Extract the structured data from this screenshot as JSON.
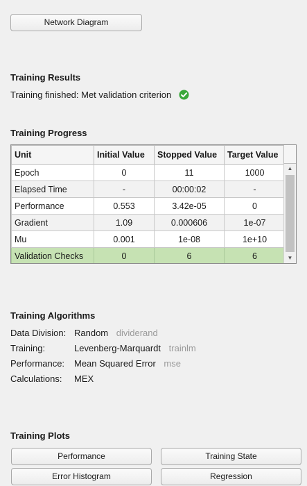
{
  "network_diagram_button": "Network Diagram",
  "results": {
    "heading": "Training Results",
    "status_text": "Training finished: Met validation criterion"
  },
  "progress": {
    "heading": "Training Progress",
    "columns": [
      "Unit",
      "Initial Value",
      "Stopped Value",
      "Target Value"
    ],
    "rows": [
      {
        "unit": "Epoch",
        "initial": "0",
        "stopped": "11",
        "target": "1000"
      },
      {
        "unit": "Elapsed Time",
        "initial": "-",
        "stopped": "00:00:02",
        "target": "-"
      },
      {
        "unit": "Performance",
        "initial": "0.553",
        "stopped": "3.42e-05",
        "target": "0"
      },
      {
        "unit": "Gradient",
        "initial": "1.09",
        "stopped": "0.000606",
        "target": "1e-07"
      },
      {
        "unit": "Mu",
        "initial": "0.001",
        "stopped": "1e-08",
        "target": "1e+10"
      },
      {
        "unit": "Validation Checks",
        "initial": "0",
        "stopped": "6",
        "target": "6"
      }
    ]
  },
  "algorithms": {
    "heading": "Training Algorithms",
    "items": [
      {
        "label": "Data Division:",
        "value": "Random",
        "func": "dividerand"
      },
      {
        "label": "Training:",
        "value": "Levenberg-Marquardt",
        "func": "trainlm"
      },
      {
        "label": "Performance:",
        "value": "Mean Squared Error",
        "func": "mse"
      },
      {
        "label": "Calculations:",
        "value": "MEX",
        "func": ""
      }
    ]
  },
  "plots": {
    "heading": "Training Plots",
    "buttons": [
      "Performance",
      "Training State",
      "Error Histogram",
      "Regression"
    ]
  },
  "colors": {
    "highlight_row": "#c6e2b3",
    "success_icon": "#3aa83a"
  }
}
